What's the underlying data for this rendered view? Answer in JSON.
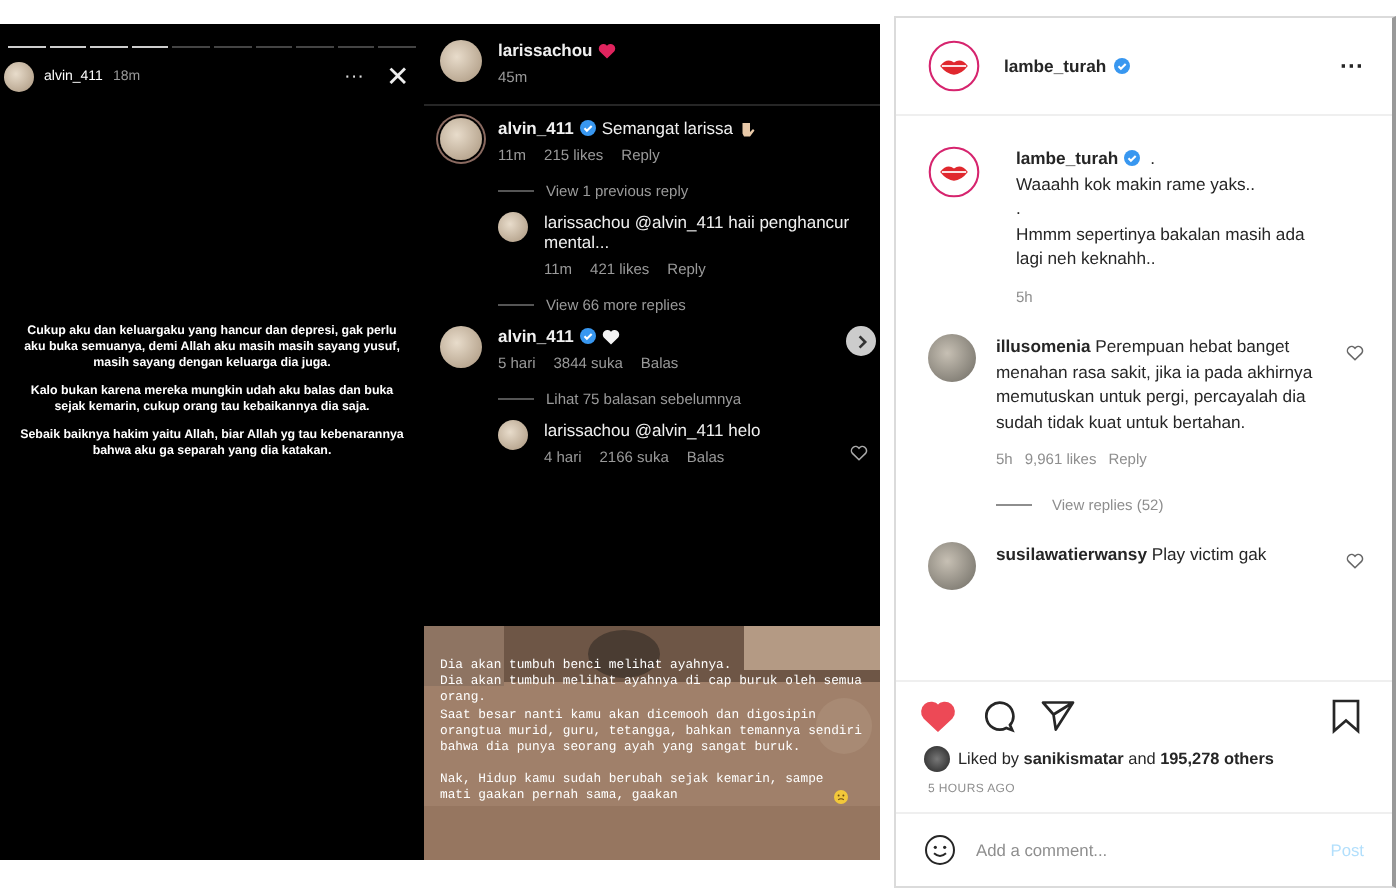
{
  "post_image": {
    "story": {
      "username": "alvin_411",
      "time": "18m",
      "more": "···",
      "close": "✕",
      "paragraphs": [
        "Cukup aku dan keluargaku yang hancur dan depresi, gak perlu aku buka semuanya, demi Allah aku masih masih sayang yusuf, masih sayang dengan keluarga dia juga.",
        "Kalo bukan karena mereka mungkin udah aku balas dan buka sejak kemarin, cukup orang tau kebaikannya dia saja.",
        "Sebaik baiknya hakim yaitu Allah, biar Allah yg tau kebenarannya bahwa aku ga separah yang dia katakan."
      ]
    },
    "comments": [
      {
        "username": "larissachou",
        "verified": false,
        "kind": "red_heart",
        "time": "45m",
        "divider_after": true
      },
      {
        "username": "alvin_411",
        "verified": true,
        "text": "Semangat larissa",
        "kind": "hand",
        "time": "11m",
        "likes": "215 likes",
        "reply": "Reply",
        "view_replies": "View 1 previous reply",
        "replies": [
          {
            "username": "larissachou",
            "text": "@alvin_411 haii penghancur mental...",
            "time": "11m",
            "likes": "421 likes",
            "reply": "Reply",
            "heart_button": false
          }
        ],
        "more_replies": "View 66 more replies"
      },
      {
        "username": "alvin_411",
        "verified": true,
        "kind": "white_heart",
        "time": "5 hari",
        "likes": "3844 suka",
        "reply": "Balas",
        "view_replies": "Lihat 75 balasan sebelumnya",
        "replies": [
          {
            "username": "larissachou",
            "text": "@alvin_411 helo",
            "time": "4 hari",
            "likes": "2166 suka",
            "reply": "Balas",
            "heart_button": true
          }
        ]
      }
    ],
    "photo_text": {
      "lines": [
        "Dia akan tumbuh benci melihat ayahnya.",
        "Dia akan tumbuh melihat ayahnya di cap buruk oleh semua orang.",
        "Saat besar nanti kamu akan dicemooh dan digosipin orangtua murid, guru, tetangga, bahkan temannya sendiri bahwa dia punya seorang ayah yang sangat buruk."
      ],
      "ending": "Nak, Hidup kamu sudah berubah sejak kemarin, sampe mati gaakan pernah sama, gaakan"
    }
  },
  "sidebar": {
    "header": {
      "username": "lambe_turah",
      "verified": true,
      "more": "···"
    },
    "caption": {
      "username": "lambe_turah",
      "verified": true,
      "text": ".",
      "lines": [
        "Waaahh kok makin rame yaks..",
        ".",
        "Hmmm sepertinya bakalan masih ada lagi neh keknahh.."
      ],
      "time": "5h"
    },
    "comments": [
      {
        "text": "**illusomenia** Perempuan hebat banget menahan rasa sakit, jika ia pada akhirnya memutuskan untuk pergi, percayalah dia sudah tidak kuat untuk bertahan.",
        "time": "5h",
        "likes": "9,961 likes",
        "reply": "Reply",
        "view_replies": "View replies (52)",
        "liked": false
      },
      {
        "text": "**susilawatierwansy** Play victim gak",
        "liked": false
      }
    ],
    "liked": true,
    "likes_text": "Liked by **sanikismatar** and **195,278 others**",
    "time_ago": "5 HOURS AGO",
    "comment_field": {
      "placeholder": "Add a comment...",
      "post": "Post",
      "disabled": true
    }
  }
}
